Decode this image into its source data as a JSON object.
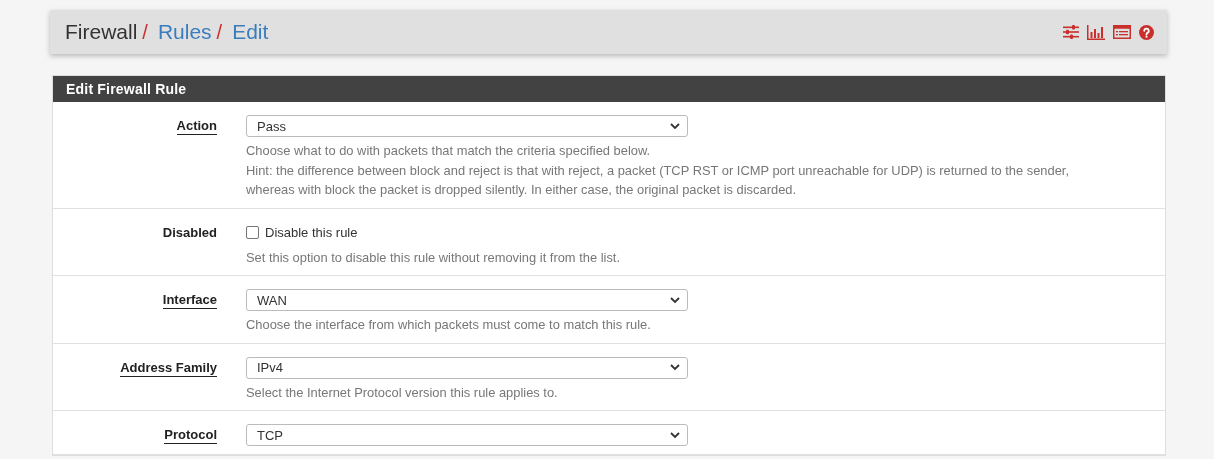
{
  "breadcrumb_separator": "/",
  "breadcrumb": [
    {
      "label": "Firewall",
      "link": false
    },
    {
      "label": "Rules",
      "link": true
    },
    {
      "label": "Edit",
      "link": true
    }
  ],
  "panel": {
    "title": "Edit Firewall Rule"
  },
  "rows": [
    {
      "kind": "select",
      "label": "Action",
      "help_link": true,
      "value": "Pass",
      "help": [
        "Choose what to do with packets that match the criteria specified below.",
        "Hint: the difference between block and reject is that with reject, a packet (TCP RST or ICMP port unreachable for UDP) is returned to the sender, whereas with block the packet is dropped silently. In either case, the original packet is discarded."
      ]
    },
    {
      "kind": "checkbox",
      "label": "Disabled",
      "help_link": false,
      "checkbox_label": "Disable this rule",
      "checked": false,
      "help": [
        "Set this option to disable this rule without removing it from the list."
      ]
    },
    {
      "kind": "select",
      "label": "Interface",
      "help_link": true,
      "value": "WAN",
      "help": [
        "Choose the interface from which packets must come to match this rule."
      ]
    },
    {
      "kind": "select",
      "label": "Address Family",
      "help_link": true,
      "value": "IPv4",
      "help": [
        "Select the Internet Protocol version this rule applies to."
      ]
    },
    {
      "kind": "select",
      "label": "Protocol",
      "help_link": true,
      "value": "TCP",
      "help": []
    }
  ]
}
